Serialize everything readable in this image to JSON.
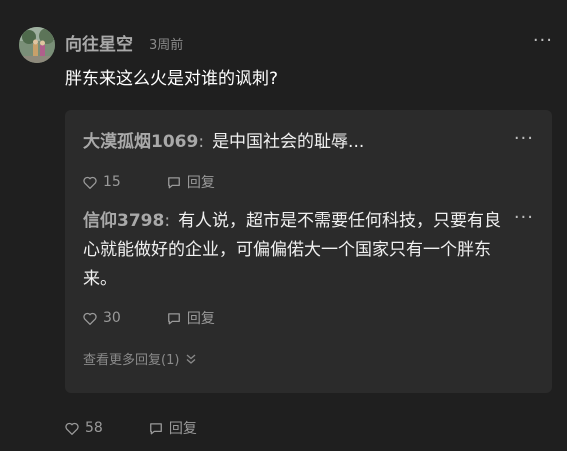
{
  "comment": {
    "author": "向往星空",
    "time": "3周前",
    "content": "胖东来这么火是对谁的讽刺?",
    "likes": "58",
    "reply_label": "回复"
  },
  "replies": [
    {
      "user": "大漠孤烟1069",
      "colon": ":",
      "text": "是中国社会的耻辱...",
      "likes": "15",
      "reply_label": "回复"
    },
    {
      "user": "信仰3798",
      "colon": ":",
      "text": "有人说，超市是不需要任何科技，只要有良心就能做好的企业，可偏偏偌大一个国家只有一个胖东来。",
      "likes": "30",
      "reply_label": "回复"
    }
  ],
  "view_more": "查看更多回复(1)",
  "more_glyph": "···",
  "icons": [
    "heart-icon",
    "comment-icon",
    "chevron-down-icon",
    "more-icon"
  ]
}
